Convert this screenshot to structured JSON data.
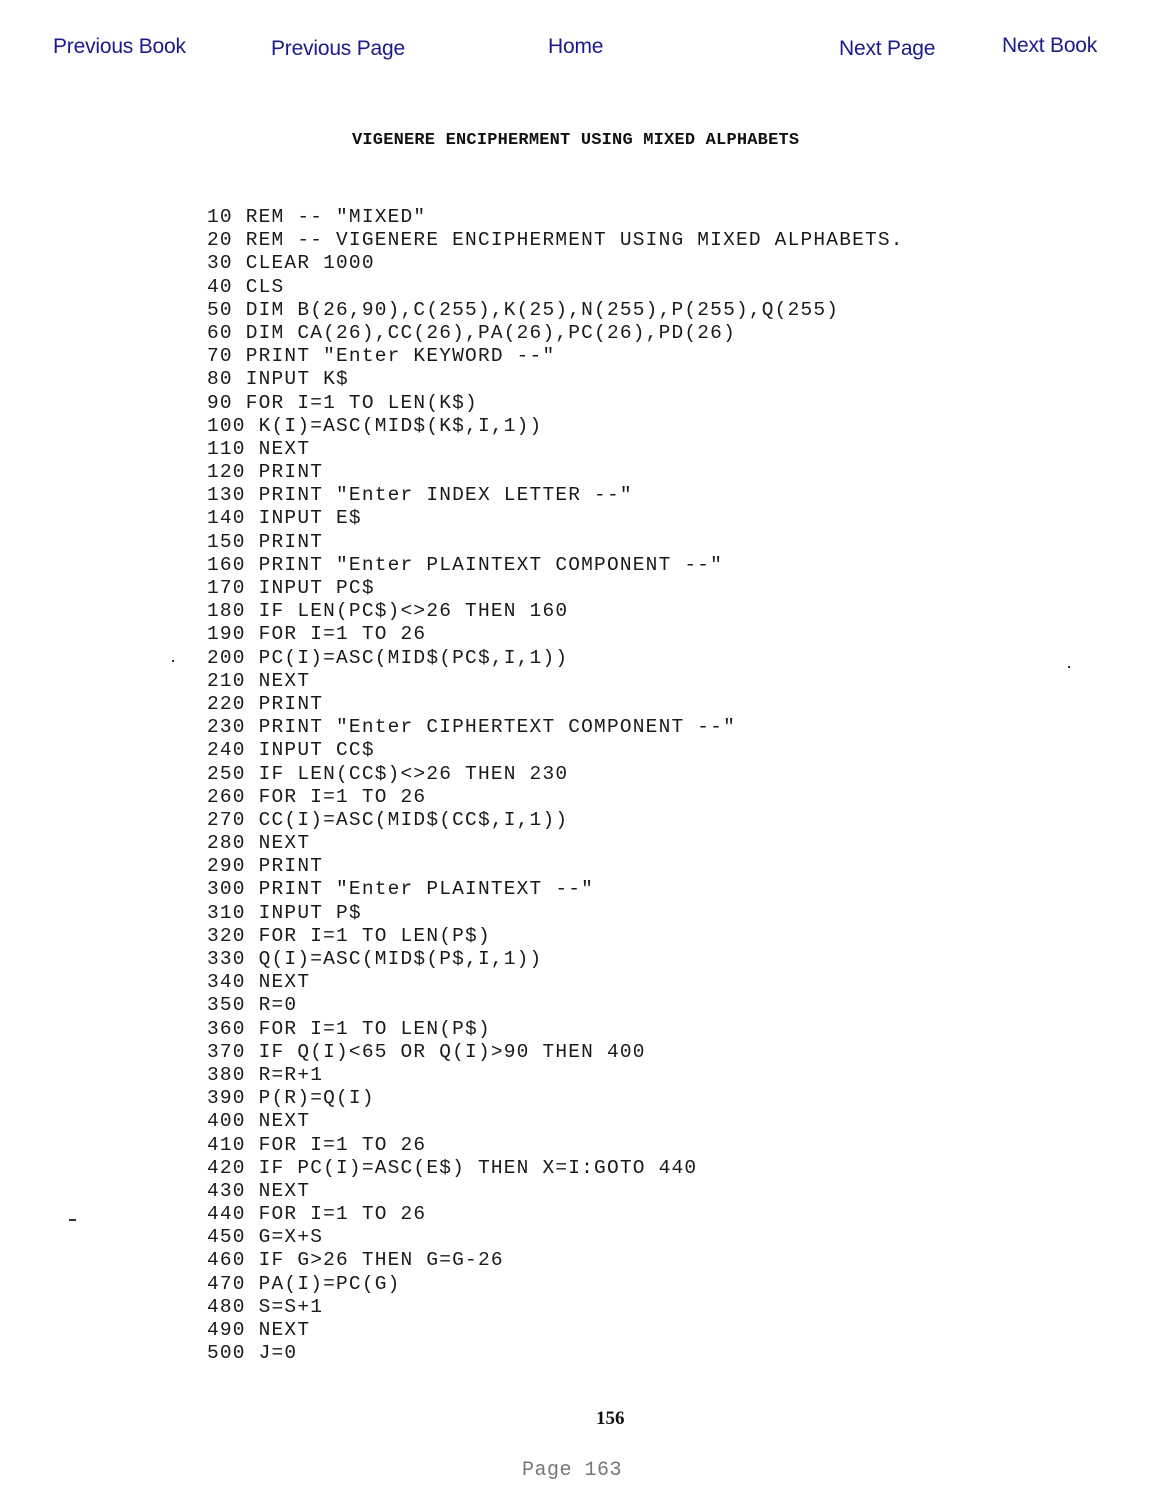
{
  "nav": {
    "previous_book": "Previous Book",
    "previous_page": "Previous Page",
    "home": "Home",
    "next_page": "Next Page",
    "next_book": "Next Book",
    "link_color": "#1a1a8c"
  },
  "document": {
    "title": "VIGENERE ENCIPHERMENT USING MIXED ALPHABETS",
    "code_lines": [
      "10 REM -- \"MIXED\"",
      "20 REM -- VIGENERE ENCIPHERMENT USING MIXED ALPHABETS.",
      "30 CLEAR 1000",
      "40 CLS",
      "50 DIM B(26,90),C(255),K(25),N(255),P(255),Q(255)",
      "60 DIM CA(26),CC(26),PA(26),PC(26),PD(26)",
      "70 PRINT \"Enter KEYWORD --\"",
      "80 INPUT K$",
      "90 FOR I=1 TO LEN(K$)",
      "100 K(I)=ASC(MID$(K$,I,1))",
      "110 NEXT",
      "120 PRINT",
      "130 PRINT \"Enter INDEX LETTER --\"",
      "140 INPUT E$",
      "150 PRINT",
      "160 PRINT \"Enter PLAINTEXT COMPONENT --\"",
      "170 INPUT PC$",
      "180 IF LEN(PC$)<>26 THEN 160",
      "190 FOR I=1 TO 26",
      "200 PC(I)=ASC(MID$(PC$,I,1))",
      "210 NEXT",
      "220 PRINT",
      "230 PRINT \"Enter CIPHERTEXT COMPONENT --\"",
      "240 INPUT CC$",
      "250 IF LEN(CC$)<>26 THEN 230",
      "260 FOR I=1 TO 26",
      "270 CC(I)=ASC(MID$(CC$,I,1))",
      "280 NEXT",
      "290 PRINT",
      "300 PRINT \"Enter PLAINTEXT --\"",
      "310 INPUT P$",
      "320 FOR I=1 TO LEN(P$)",
      "330 Q(I)=ASC(MID$(P$,I,1))",
      "340 NEXT",
      "350 R=0",
      "360 FOR I=1 TO LEN(P$)",
      "370 IF Q(I)<65 OR Q(I)>90 THEN 400",
      "380 R=R+1",
      "390 P(R)=Q(I)",
      "400 NEXT",
      "410 FOR I=1 TO 26",
      "420 IF PC(I)=ASC(E$) THEN X=I:GOTO 440",
      "430 NEXT",
      "440 FOR I=1 TO 26",
      "450 G=X+S",
      "460 IF G>26 THEN G=G-26",
      "470 PA(I)=PC(G)",
      "480 S=S+1",
      "490 NEXT",
      "500 J=0"
    ],
    "printed_page_number": "156"
  },
  "footer": {
    "page_indicator": "Page 163"
  }
}
